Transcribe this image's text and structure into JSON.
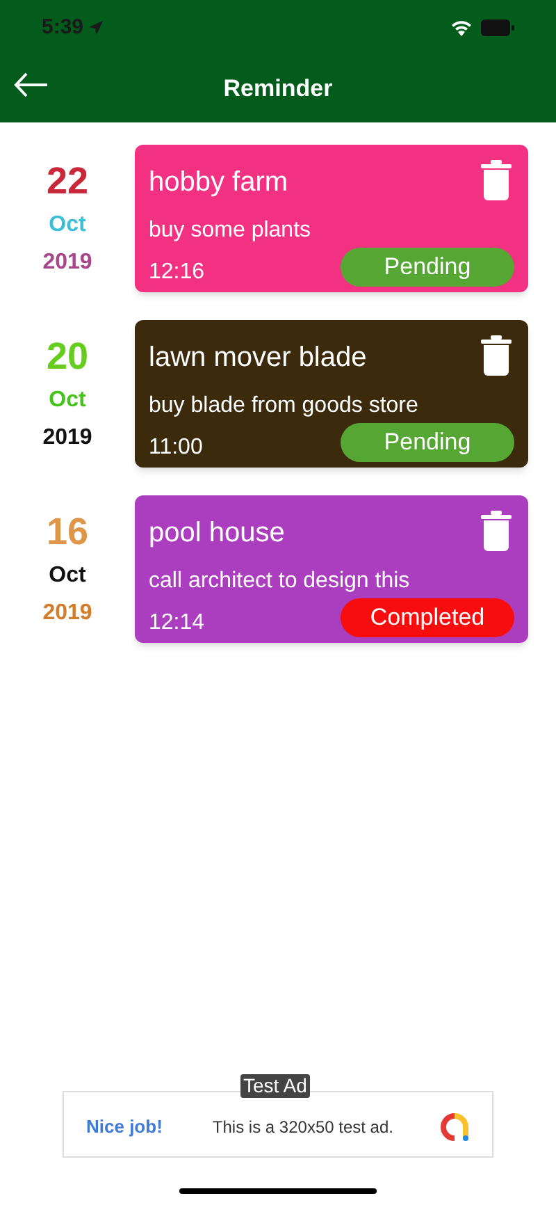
{
  "status_bar": {
    "time": "5:39"
  },
  "header": {
    "title": "Reminder"
  },
  "reminders": [
    {
      "day": {
        "text": "22",
        "color": "#c8283a"
      },
      "month": {
        "text": "Oct",
        "color": "#3bbfd6"
      },
      "year": {
        "text": "2019",
        "color": "#a8468a"
      },
      "title": "hobby farm",
      "note": "buy some plants",
      "time": "12:16",
      "status": "Pending",
      "kind": "pending",
      "color": "#f23183"
    },
    {
      "day": {
        "text": "20",
        "color": "#66cc1e"
      },
      "month": {
        "text": "Oct",
        "color": "#44c41a"
      },
      "year": {
        "text": "2019",
        "color": "#111111"
      },
      "title": "lawn mover blade",
      "note": "buy blade from goods store",
      "time": "11:00",
      "status": "Pending",
      "kind": "pending",
      "color": "#3b2a0c"
    },
    {
      "day": {
        "text": "16",
        "color": "#e0964a"
      },
      "month": {
        "text": "Oct",
        "color": "#111111"
      },
      "year": {
        "text": "2019",
        "color": "#d37d2a"
      },
      "title": "pool house",
      "note": "call architect to design this",
      "time": "12:14",
      "status": "Completed",
      "kind": "completed",
      "color": "#ab3ebe"
    }
  ],
  "ad": {
    "label": "Test Ad",
    "headline": "Nice job!",
    "text": "This is a 320x50 test ad."
  }
}
